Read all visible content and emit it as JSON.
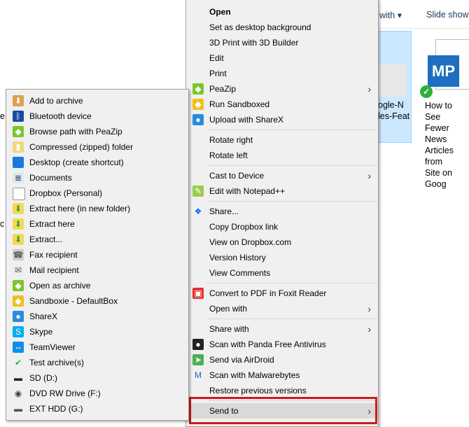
{
  "explorer": {
    "toolbar": {
      "share_with": "with ▾",
      "slide_show": "Slide show"
    },
    "files": [
      {
        "name_line1": "ogle-N",
        "name_line2": "les-Feat"
      },
      {
        "name_lines": [
          "How to See",
          "Fewer News",
          "Articles from",
          "Site on Goog"
        ],
        "icon_text": "MP"
      }
    ],
    "left_fragments": [
      "e",
      "c"
    ]
  },
  "context_menu": {
    "items": [
      {
        "label": "Open",
        "bold": true
      },
      {
        "label": "Set as desktop background"
      },
      {
        "label": "3D Print with 3D Builder"
      },
      {
        "label": "Edit"
      },
      {
        "label": "Print"
      },
      {
        "label": "PeaZip",
        "icon": "peazip-icon",
        "submenu": true
      },
      {
        "label": "Run Sandboxed",
        "icon": "sandboxie-icon"
      },
      {
        "label": "Upload with ShareX",
        "icon": "sharex-icon"
      },
      {
        "label": "Rotate right"
      },
      {
        "label": "Rotate left"
      },
      {
        "label": "Cast to Device",
        "submenu": true
      },
      {
        "label": "Edit with Notepad++",
        "icon": "notepadpp-icon"
      },
      {
        "label": "Share...",
        "icon": "dropbox-icon"
      },
      {
        "label": "Copy Dropbox link"
      },
      {
        "label": "View on Dropbox.com"
      },
      {
        "label": "Version History"
      },
      {
        "label": "View Comments"
      },
      {
        "label": "Convert to PDF in Foxit Reader",
        "icon": "foxit-icon"
      },
      {
        "label": "Open with",
        "submenu": true
      },
      {
        "label": "Share with",
        "submenu": true
      },
      {
        "label": "Scan with Panda Free Antivirus",
        "icon": "panda-icon"
      },
      {
        "label": "Send via AirDroid",
        "icon": "airdroid-icon"
      },
      {
        "label": "Scan with Malwarebytes",
        "icon": "malwarebytes-icon"
      },
      {
        "label": "Restore previous versions"
      },
      {
        "label": "Send to",
        "submenu": true,
        "highlighted": true
      }
    ]
  },
  "send_to_menu": {
    "items": [
      {
        "label": "Add to archive",
        "icon": "archive-add-icon"
      },
      {
        "label": "Bluetooth device",
        "icon": "bluetooth-icon"
      },
      {
        "label": "Browse path with PeaZip",
        "icon": "peazip-icon"
      },
      {
        "label": "Compressed (zipped) folder",
        "icon": "zip-folder-icon"
      },
      {
        "label": "Desktop (create shortcut)",
        "icon": "desktop-icon"
      },
      {
        "label": "Documents",
        "icon": "documents-icon"
      },
      {
        "label": "Dropbox (Personal)",
        "icon": "blank-file-icon"
      },
      {
        "label": "Extract here (in new folder)",
        "icon": "extract-icon"
      },
      {
        "label": "Extract here",
        "icon": "extract-icon"
      },
      {
        "label": "Extract...",
        "icon": "extract-icon"
      },
      {
        "label": "Fax recipient",
        "icon": "fax-icon"
      },
      {
        "label": "Mail recipient",
        "icon": "mail-icon"
      },
      {
        "label": "Open as archive",
        "icon": "peazip-icon"
      },
      {
        "label": "Sandboxie - DefaultBox",
        "icon": "sandboxie-icon"
      },
      {
        "label": "ShareX",
        "icon": "sharex-icon"
      },
      {
        "label": "Skype",
        "icon": "skype-icon"
      },
      {
        "label": "TeamViewer",
        "icon": "teamviewer-icon"
      },
      {
        "label": "Test archive(s)",
        "icon": "check-icon"
      },
      {
        "label": "SD (D:)",
        "icon": "sd-drive-icon"
      },
      {
        "label": "DVD RW Drive (F:)",
        "icon": "dvd-drive-icon"
      },
      {
        "label": "EXT HDD (G:)",
        "icon": "hdd-icon"
      }
    ]
  },
  "colors": {
    "highlight_border": "#d11a1a",
    "selection": "#cce8ff"
  }
}
